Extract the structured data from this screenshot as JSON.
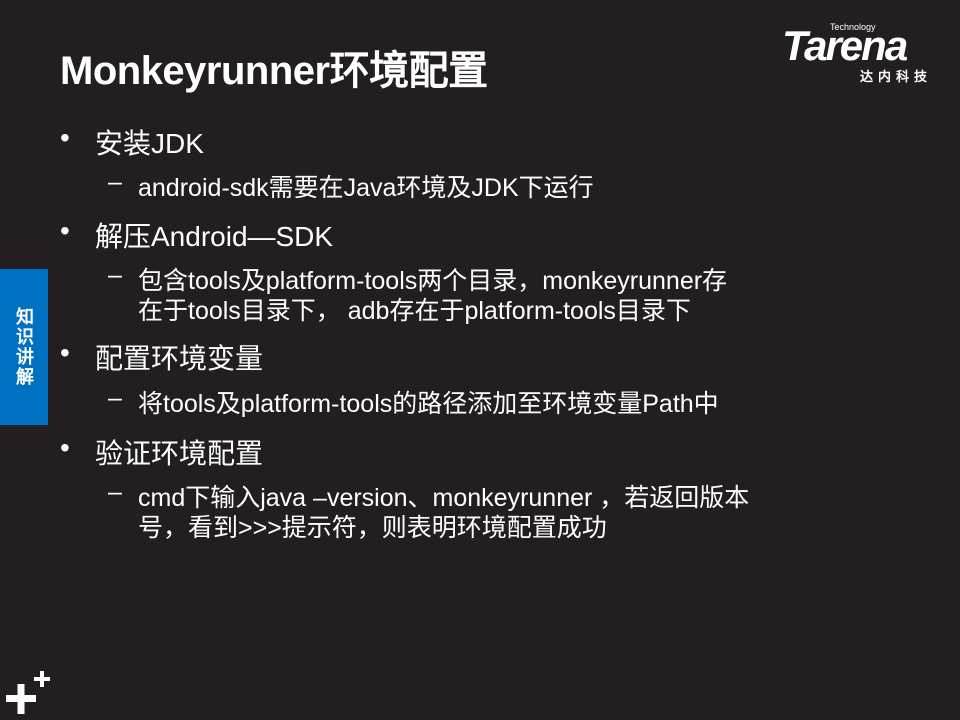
{
  "title": "Monkeyrunner环境配置",
  "logo": {
    "tech": "Technology",
    "name": "Tarena",
    "cn": "达内科技"
  },
  "side_tab": "知识讲解",
  "bullets": [
    {
      "text": "安装JDK",
      "sub": [
        [
          "android-sdk需要在Java环境及JDK下运行"
        ]
      ]
    },
    {
      "text": "解压Android—SDK",
      "sub": [
        [
          "包含tools及platform-tools两个目录，monkeyrunner存",
          "在于tools目录下， adb存在于platform-tools目录下"
        ]
      ]
    },
    {
      "text": "配置环境变量",
      "sub": [
        [
          "将tools及platform-tools的路径添加至环境变量Path中"
        ]
      ]
    },
    {
      "text": "验证环境配置",
      "sub": [
        [
          "cmd下输入java –version、monkeyrunner ，若返回版本",
          "号，看到>>>提示符，则表明环境配置成功"
        ]
      ]
    }
  ],
  "bullet_char": "•",
  "dash_char": "–"
}
